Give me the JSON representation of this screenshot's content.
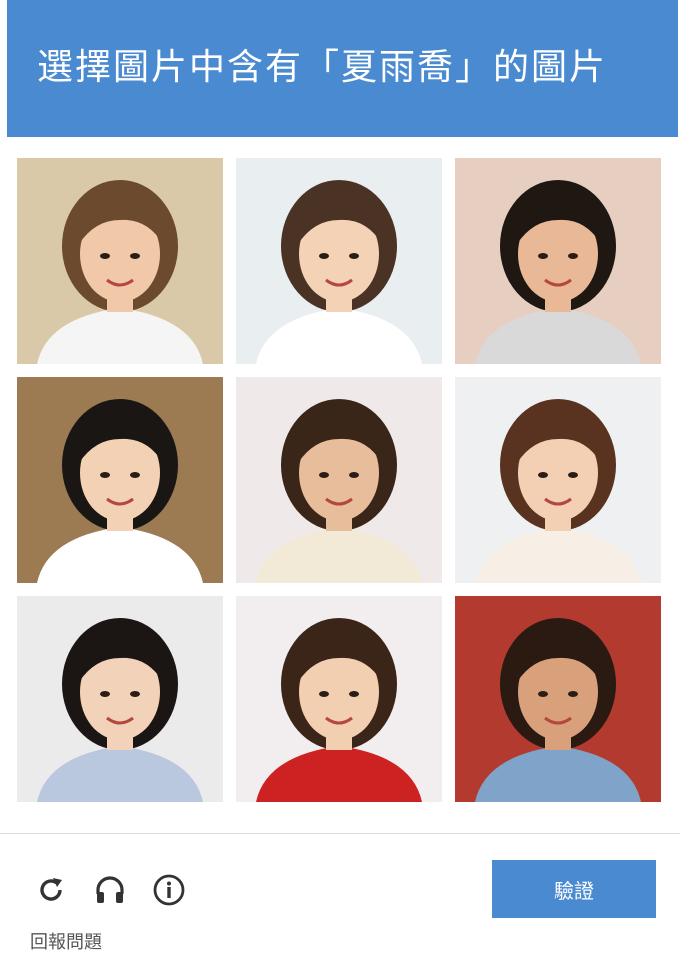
{
  "header": {
    "title": "選擇圖片中含有「夏雨喬」的圖片"
  },
  "grid": {
    "tiles": [
      {
        "bg": "#d9c9a8",
        "hair": "#6b4a2e",
        "skin": "#f2c9a8",
        "top": "#f5f5f5"
      },
      {
        "bg": "#e9eef0",
        "hair": "#4a3324",
        "skin": "#f3d2b6",
        "top": "#ffffff"
      },
      {
        "bg": "#e6cfc0",
        "hair": "#1f1712",
        "skin": "#e9b897",
        "top": "#d9d9d9"
      },
      {
        "bg": "#9c7a52",
        "hair": "#1a1614",
        "skin": "#f2d1b5",
        "top": "#ffffff"
      },
      {
        "bg": "#efe9ea",
        "hair": "#3a2618",
        "skin": "#e8bd9b",
        "top": "#f2ead6"
      },
      {
        "bg": "#eef0f2",
        "hair": "#5a3320",
        "skin": "#f3d0b3",
        "top": "#f7efe6"
      },
      {
        "bg": "#ecebeb",
        "hair": "#1b1614",
        "skin": "#f2d3b9",
        "top": "#b9c8de"
      },
      {
        "bg": "#f2eef0",
        "hair": "#3b2418",
        "skin": "#f3cfb2",
        "top": "#cc2222"
      },
      {
        "bg": "#b23a2e",
        "hair": "#2a1a12",
        "skin": "#d9a07c",
        "top": "#7fa3c9"
      }
    ]
  },
  "footer": {
    "reload_icon": "reload-icon",
    "audio_icon": "headphones-icon",
    "info_icon": "info-icon",
    "report_label": "回報問題",
    "verify_label": "驗證"
  },
  "colors": {
    "accent": "#4a8ad1"
  }
}
